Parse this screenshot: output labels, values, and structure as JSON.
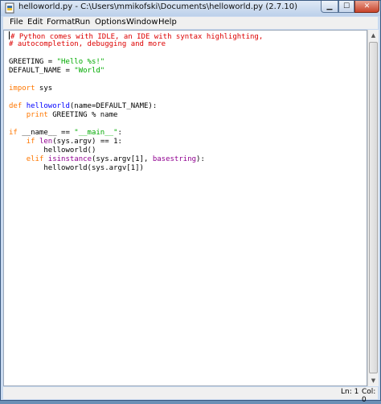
{
  "window": {
    "title": "helloworld.py - C:\\Users\\mmikofski\\Documents\\helloworld.py (2.7.10)",
    "minimize_label": "▁",
    "maximize_label": "☐",
    "close_label": "✕"
  },
  "menu": [
    {
      "label": "File"
    },
    {
      "label": "Edit"
    },
    {
      "label": "Format"
    },
    {
      "label": "Run"
    },
    {
      "label": "Options"
    },
    {
      "label": "Window"
    },
    {
      "label": "Help"
    }
  ],
  "code_lines": [
    [
      {
        "t": "# Python comes with IDLE, an IDE with syntax highlighting,",
        "c": "comment"
      }
    ],
    [
      {
        "t": "# autocompletion, debugging and more",
        "c": "comment"
      }
    ],
    [],
    [
      {
        "t": "GREETING = ",
        "c": "plain"
      },
      {
        "t": "\"Hello %s!\"",
        "c": "string"
      }
    ],
    [
      {
        "t": "DEFAULT_NAME = ",
        "c": "plain"
      },
      {
        "t": "\"World\"",
        "c": "string"
      }
    ],
    [],
    [
      {
        "t": "import",
        "c": "keyword"
      },
      {
        "t": " sys",
        "c": "plain"
      }
    ],
    [],
    [
      {
        "t": "def",
        "c": "keyword"
      },
      {
        "t": " ",
        "c": "plain"
      },
      {
        "t": "helloworld",
        "c": "def"
      },
      {
        "t": "(name=DEFAULT_NAME):",
        "c": "plain"
      }
    ],
    [
      {
        "t": "    ",
        "c": "plain"
      },
      {
        "t": "print",
        "c": "keyword"
      },
      {
        "t": " GREETING % name",
        "c": "plain"
      }
    ],
    [],
    [
      {
        "t": "if",
        "c": "keyword"
      },
      {
        "t": " __name__ == ",
        "c": "plain"
      },
      {
        "t": "\"__main__\"",
        "c": "string"
      },
      {
        "t": ":",
        "c": "plain"
      }
    ],
    [
      {
        "t": "    ",
        "c": "plain"
      },
      {
        "t": "if",
        "c": "keyword"
      },
      {
        "t": " ",
        "c": "plain"
      },
      {
        "t": "len",
        "c": "builtin"
      },
      {
        "t": "(sys.argv) == 1:",
        "c": "plain"
      }
    ],
    [
      {
        "t": "        helloworld()",
        "c": "plain"
      }
    ],
    [
      {
        "t": "    ",
        "c": "plain"
      },
      {
        "t": "elif",
        "c": "keyword"
      },
      {
        "t": " ",
        "c": "plain"
      },
      {
        "t": "isinstance",
        "c": "builtin"
      },
      {
        "t": "(sys.argv[1], ",
        "c": "plain"
      },
      {
        "t": "basestring",
        "c": "builtin"
      },
      {
        "t": "):",
        "c": "plain"
      }
    ],
    [
      {
        "t": "        helloworld(sys.argv[1])",
        "c": "plain"
      }
    ]
  ],
  "status": {
    "line": "Ln: 1",
    "column": "Col: 0"
  },
  "colors": {
    "comment": "#dd0000",
    "string": "#00aa00",
    "keyword": "#ff7700",
    "builtin": "#900090",
    "def": "#0000ff"
  }
}
